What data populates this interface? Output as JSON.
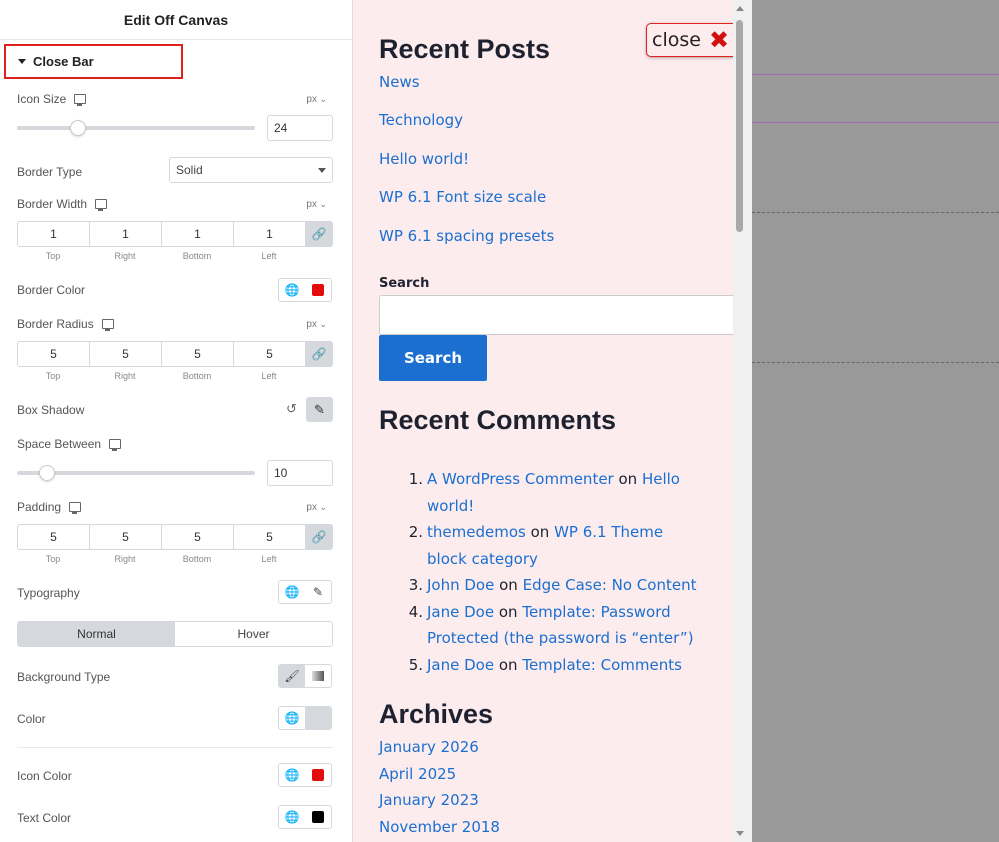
{
  "panel": {
    "title": "Edit Off Canvas",
    "section": "Close Bar",
    "icon_size": {
      "label": "Icon Size",
      "unit": "px",
      "value": "24",
      "slider_fraction": 0.24
    },
    "border_type": {
      "label": "Border Type",
      "value": "Solid"
    },
    "border_width": {
      "label": "Border Width",
      "unit": "px",
      "values": [
        "1",
        "1",
        "1",
        "1"
      ]
    },
    "dim_labels": [
      "Top",
      "Right",
      "Bottom",
      "Left"
    ],
    "border_color": {
      "label": "Border Color",
      "color": "#e30b0b"
    },
    "border_radius": {
      "label": "Border Radius",
      "unit": "px",
      "values": [
        "5",
        "5",
        "5",
        "5"
      ]
    },
    "box_shadow": {
      "label": "Box Shadow"
    },
    "space_between": {
      "label": "Space Between",
      "value": "10",
      "slider_fraction": 0.1
    },
    "padding": {
      "label": "Padding",
      "unit": "px",
      "values": [
        "5",
        "5",
        "5",
        "5"
      ]
    },
    "typography": {
      "label": "Typography"
    },
    "tabs": [
      "Normal",
      "Hover"
    ],
    "background_type": {
      "label": "Background Type"
    },
    "color": {
      "label": "Color",
      "color": "#d5d8dc"
    },
    "icon_color": {
      "label": "Icon Color",
      "color": "#e30b0b"
    },
    "text_color": {
      "label": "Text Color",
      "color": "#000000"
    }
  },
  "preview": {
    "close_text": "close",
    "close_icon": "x-icon",
    "recent_posts_title": "Recent Posts",
    "recent_posts": [
      "News",
      "Technology",
      "Hello world!",
      "WP 6.1 Font size scale",
      "WP 6.1 spacing presets"
    ],
    "search_label": "Search",
    "search_button": "Search",
    "recent_comments_title": "Recent Comments",
    "comments": [
      {
        "num": "1.",
        "author": "A WordPress Commenter",
        "on": "on",
        "post": "Hello world!"
      },
      {
        "num": "2.",
        "author": "themedemos",
        "on": "on",
        "post": "WP 6.1 Theme block category"
      },
      {
        "num": "3.",
        "author": "John Doe",
        "on": "on",
        "post": "Edge Case: No Content"
      },
      {
        "num": "4.",
        "author": "Jane Doe",
        "on": "on",
        "post": "Template: Password Protected (the password is “enter”)"
      },
      {
        "num": "5.",
        "author": "Jane Doe",
        "on": "on",
        "post": "Template: Comments"
      }
    ],
    "archives_title": "Archives",
    "archives": [
      "January 2026",
      "April 2025",
      "January 2023",
      "November 2018"
    ]
  },
  "colors": {
    "accent": "#1a6fd1",
    "highlight": "#e0221d",
    "canvas_bg": "#fdeced"
  }
}
